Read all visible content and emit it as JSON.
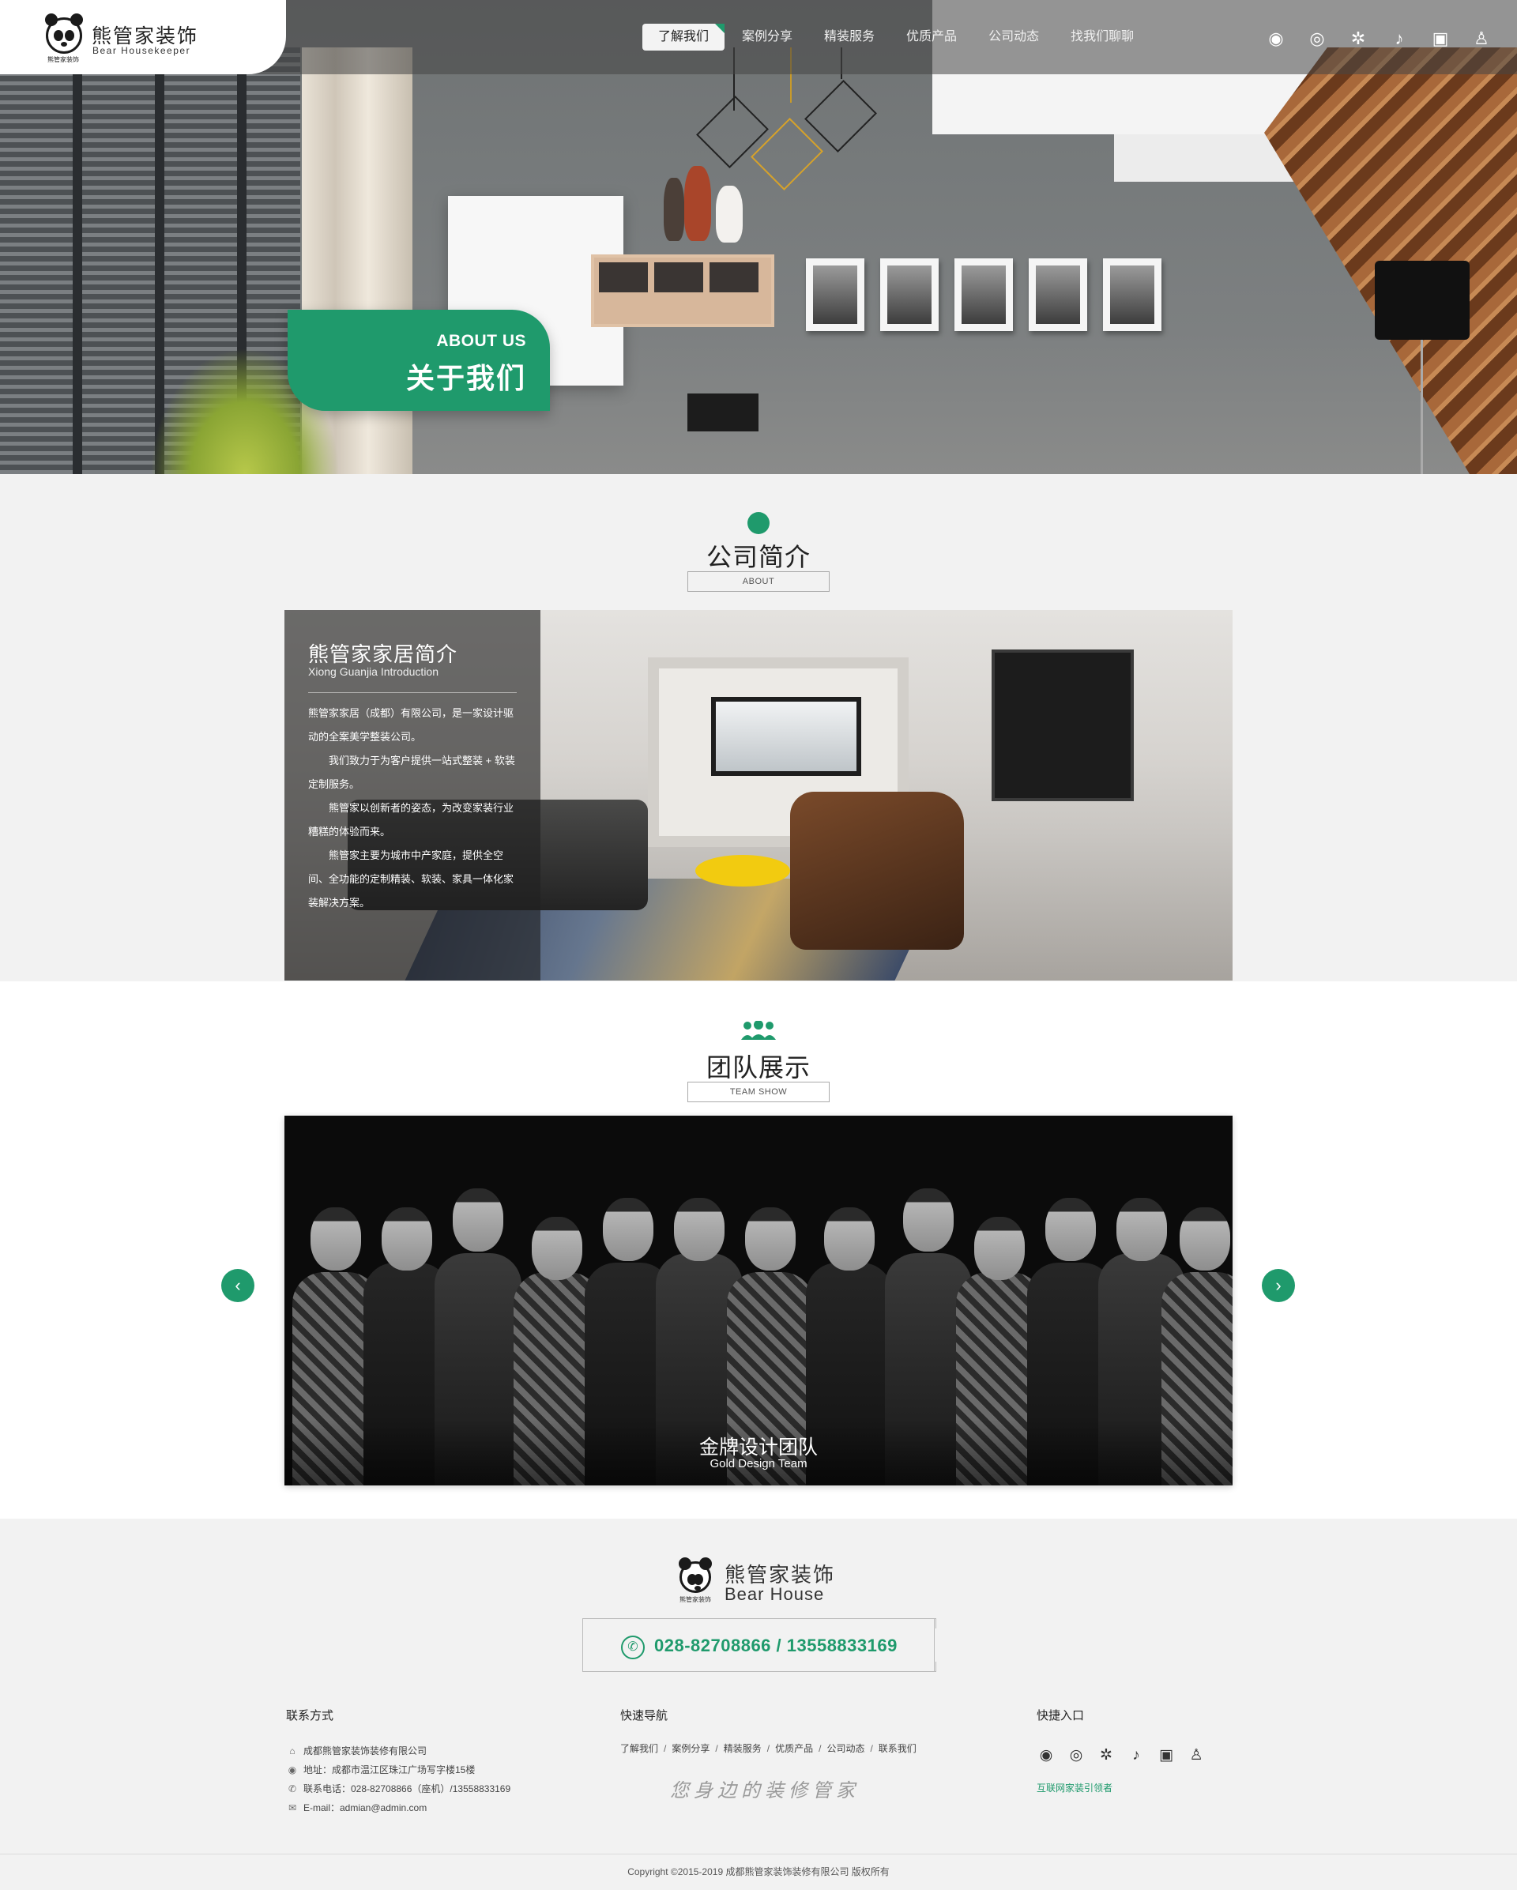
{
  "header": {
    "logo_cn": "熊管家装饰",
    "logo_en": "Bear Housekeeper",
    "logo_tag": "熊管家装饰",
    "nav": [
      "了解我们",
      "案例分享",
      "精装服务",
      "优质产品",
      "公司动态",
      "找我们聊聊"
    ],
    "active_nav": "了解我们",
    "social_icons": [
      "wechat-icon",
      "weibo-icon",
      "app-icon",
      "douyin-icon",
      "toutiao-icon",
      "panda-icon"
    ],
    "social_glyphs": [
      "◉",
      "◎",
      "✲",
      "♪",
      "▣",
      "♙"
    ]
  },
  "hero": {
    "badge_en": "ABOUT US",
    "badge_cn": "关于我们"
  },
  "about": {
    "title": "公司简介",
    "subtitle": "ABOUT",
    "panel_title": "熊管家家居简介",
    "panel_title_en": "Xiong Guanjia Introduction",
    "paragraphs": [
      "熊管家家居（成都）有限公司，是一家设计驱动的全案美学整装公司。",
      "　　我们致力于为客户提供一站式整装 + 软装定制服务。",
      "　　熊管家以创新者的姿态，为改变家装行业糟糕的体验而来。",
      "　　熊管家主要为城市中产家庭，提供全空间、全功能的定制精装、软装、家具一体化家装解决方案。"
    ]
  },
  "team": {
    "title": "团队展示",
    "subtitle": "TEAM SHOW",
    "caption_cn": "金牌设计团队",
    "caption_en": "Gold Design Team",
    "prev": "‹",
    "next": "›"
  },
  "footer": {
    "logo_cn": "熊管家装饰",
    "logo_en": "Bear House",
    "logo_tag": "熊管家装饰",
    "phone": "028-82708866 / 13558833169",
    "phone_icon": "✆",
    "contact_title": "联系方式",
    "contact": [
      {
        "icon": "home-icon",
        "glyph": "⌂",
        "text": "成都熊管家装饰装修有限公司"
      },
      {
        "icon": "location-icon",
        "glyph": "◉",
        "text": "地址：成都市温江区珠江广场写字楼15楼"
      },
      {
        "icon": "phone-icon",
        "glyph": "✆",
        "text": "联系电话：028-82708866（座机）/13558833169"
      },
      {
        "icon": "mail-icon",
        "glyph": "✉",
        "text": "E-mail：admian@admin.com"
      }
    ],
    "quicknav_title": "快速导航",
    "quicknav": [
      "了解我们",
      "案例分享",
      "精装服务",
      "优质产品",
      "公司动态",
      "联系我们"
    ],
    "quicknav_sep": "/",
    "slogan": "您身边的装修管家",
    "quick_title": "快捷入口",
    "quick_icons": [
      "wechat-icon",
      "weibo-icon",
      "app-icon",
      "douyin-icon",
      "toutiao-icon",
      "panda-icon"
    ],
    "quick_glyphs": [
      "◉",
      "◎",
      "✲",
      "♪",
      "▣",
      "♙"
    ],
    "quick_link": "互联网家装引领者",
    "copyright": "Copyright ©2015-2019   成都熊管家装饰装修有限公司 版权所有"
  },
  "colors": {
    "accent": "#1f9a6c",
    "page_bg": "#f2f2f2",
    "nav_bar": "#666666"
  }
}
